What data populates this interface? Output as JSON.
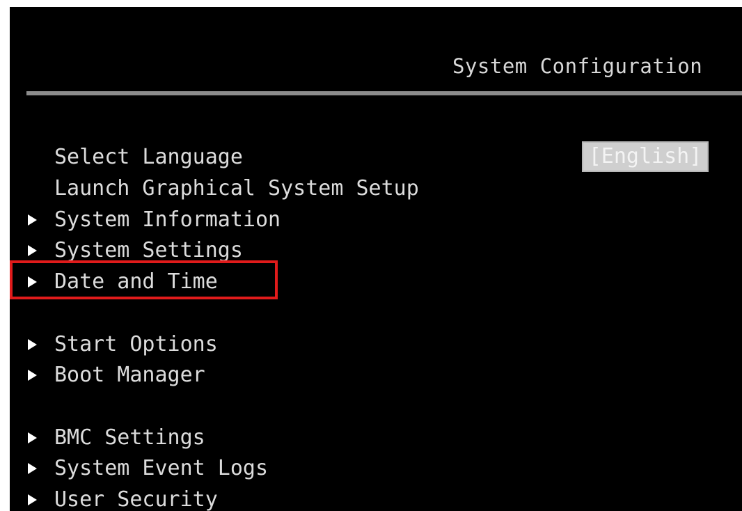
{
  "window": {
    "title": "System Configuration"
  },
  "menu": {
    "items": [
      {
        "label": "Select Language",
        "has_submenu": false,
        "value": "[English]"
      },
      {
        "label": "Launch Graphical System Setup",
        "has_submenu": false
      },
      {
        "label": "System Information",
        "has_submenu": true
      },
      {
        "label": "System Settings",
        "has_submenu": true
      },
      {
        "label": "Date and Time",
        "has_submenu": true
      },
      {
        "label": "Start Options",
        "has_submenu": true
      },
      {
        "label": "Boot Manager",
        "has_submenu": true
      },
      {
        "label": "BMC Settings",
        "has_submenu": true
      },
      {
        "label": "System Event Logs",
        "has_submenu": true
      },
      {
        "label": "User Security",
        "has_submenu": true
      }
    ]
  },
  "annotation": {
    "highlighted_item": "Date and Time",
    "highlight_color": "#e01b1b"
  },
  "colors": {
    "background": "#000000",
    "text": "#dcdcdc",
    "divider": "#8c8c8c",
    "selected_value_bg": "#cfcfcf"
  }
}
